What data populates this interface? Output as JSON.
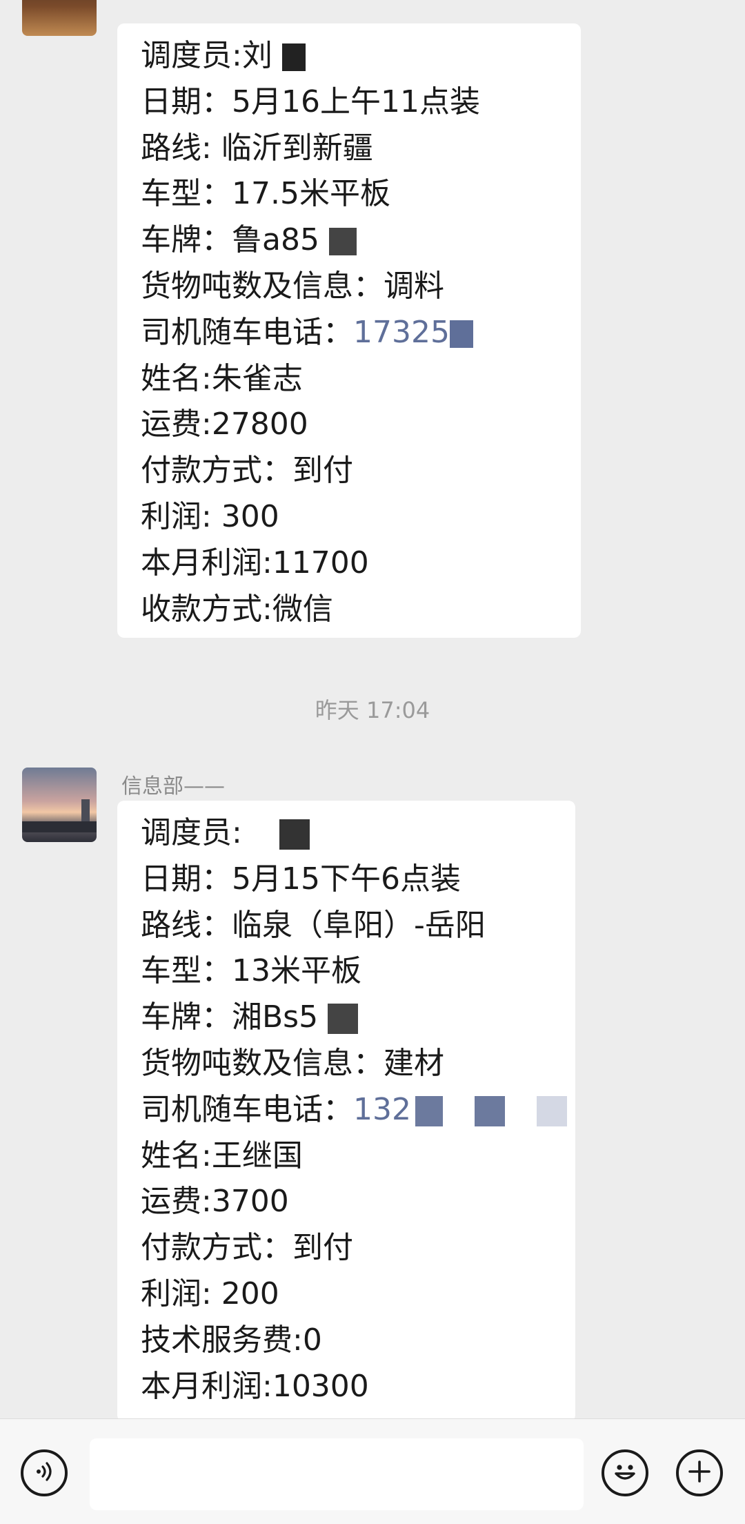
{
  "message1": {
    "lines": [
      "调度员:刘",
      "日期：5月16上午11点装",
      "路线: 临沂到新疆",
      "车型：17.5米平板",
      "车牌：鲁a85",
      "货物吨数及信息：调料",
      "司机随车电话：",
      "姓名:朱雀志",
      "运费:27800",
      "付款方式：到付",
      "利润: 300",
      "本月利润:11700",
      "收款方式:微信"
    ],
    "phone": "17325"
  },
  "timestamp": "昨天 17:04",
  "message2": {
    "sender": "信息部——",
    "lines": [
      "调度员:",
      "日期：5月15下午6点装",
      "路线：临泉（阜阳）-岳阳",
      "车型：13米平板",
      "车牌：湘Bs5",
      "货物吨数及信息：建材",
      "司机随车电话：",
      "姓名:王继国",
      "运费:3700",
      "付款方式：到付",
      "利润: 200",
      "技术服务费:0",
      "本月利润:10300"
    ],
    "phone": "132"
  },
  "bottom_bar": {
    "voice_icon": "voice-icon",
    "emoji_icon": "emoji-icon",
    "plus_icon": "plus-icon",
    "input_value": ""
  }
}
